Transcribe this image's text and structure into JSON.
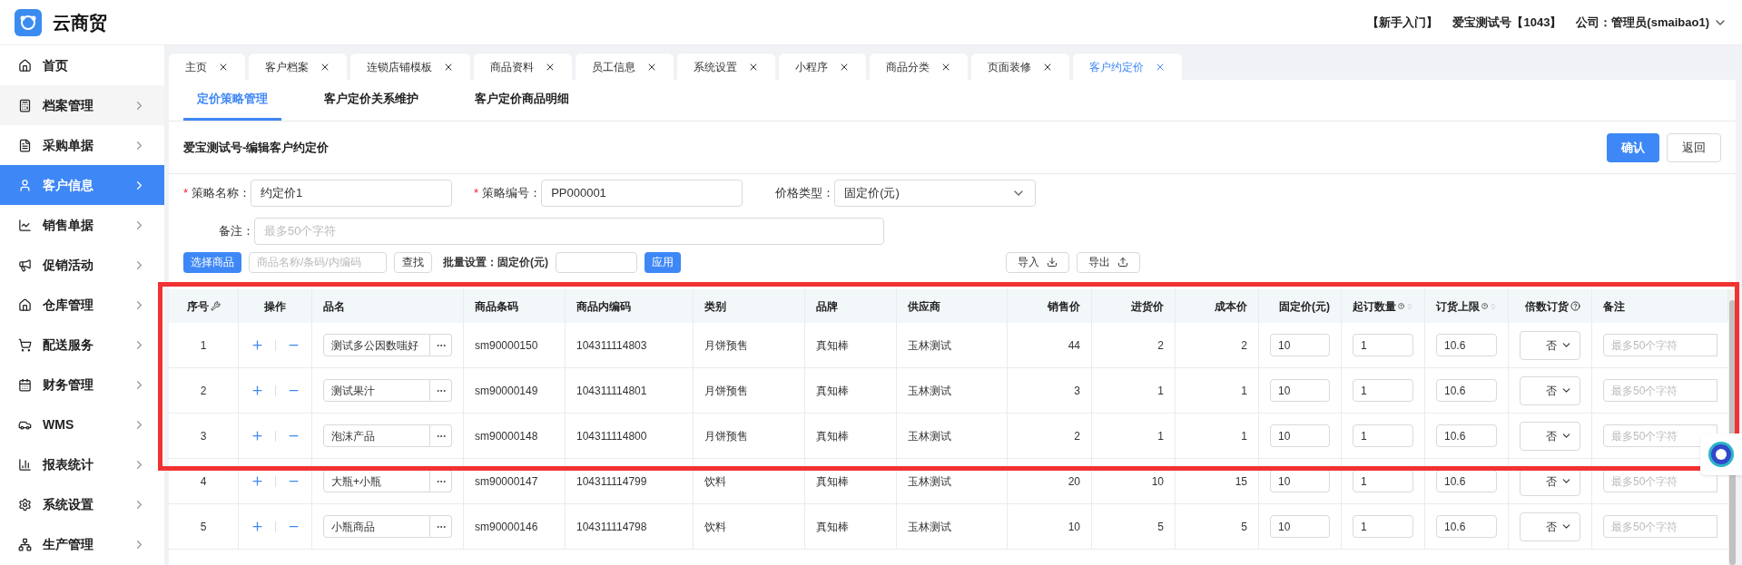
{
  "header": {
    "app_name": "云商贸",
    "links": [
      "【新手入门】",
      "爱宝测试号【1043】",
      "公司：管理员(smaibao1)"
    ]
  },
  "sidebar": {
    "items": [
      {
        "label": "首页",
        "expandable": false,
        "selected": false
      },
      {
        "label": "档案管理",
        "expandable": true,
        "selected": false
      },
      {
        "label": "采购单据",
        "expandable": true,
        "selected": false
      },
      {
        "label": "客户信息",
        "expandable": true,
        "selected": true
      },
      {
        "label": "销售单据",
        "expandable": true,
        "selected": false
      },
      {
        "label": "促销活动",
        "expandable": true,
        "selected": false
      },
      {
        "label": "仓库管理",
        "expandable": true,
        "selected": false
      },
      {
        "label": "配送服务",
        "expandable": true,
        "selected": false
      },
      {
        "label": "财务管理",
        "expandable": true,
        "selected": false
      },
      {
        "label": "WMS",
        "expandable": true,
        "selected": false
      },
      {
        "label": "报表统计",
        "expandable": true,
        "selected": false
      },
      {
        "label": "系统设置",
        "expandable": true,
        "selected": false
      },
      {
        "label": "生产管理",
        "expandable": true,
        "selected": false
      }
    ]
  },
  "tabs": [
    {
      "label": "主页",
      "selected": false
    },
    {
      "label": "客户档案",
      "selected": false
    },
    {
      "label": "连锁店铺模板",
      "selected": false
    },
    {
      "label": "商品资料",
      "selected": false
    },
    {
      "label": "员工信息",
      "selected": false
    },
    {
      "label": "系统设置",
      "selected": false
    },
    {
      "label": "小程序",
      "selected": false
    },
    {
      "label": "商品分类",
      "selected": false
    },
    {
      "label": "页面装修",
      "selected": false
    },
    {
      "label": "客户约定价",
      "selected": true
    }
  ],
  "subtabs": [
    {
      "label": "定价策略管理",
      "selected": true
    },
    {
      "label": "客户定价关系维护",
      "selected": false
    },
    {
      "label": "客户定价商品明细",
      "selected": false
    }
  ],
  "page_title": "爱宝测试号-编辑客户约定价",
  "actions": {
    "confirm": "确认",
    "back": "返回"
  },
  "form": {
    "name": {
      "required_mark": "*",
      "label": "策略名称：",
      "value": "约定价1"
    },
    "code": {
      "required_mark": "*",
      "label": "策略编号：",
      "value": "PP000001"
    },
    "price_type": {
      "label": "价格类型：",
      "value": "固定价(元)"
    },
    "remark": {
      "label": "备注：",
      "placeholder": "最多50个字符"
    }
  },
  "toolbar": {
    "select_button": "选择商品",
    "search_placeholder": "商品名称/条码/内编码",
    "find_button": "查找",
    "batch_label": "批量设置：固定价(元)",
    "apply_button": "应用",
    "import_button": "导入",
    "export_button": "导出"
  },
  "table": {
    "columns": [
      {
        "label": "序号",
        "help": false,
        "sortable": false
      },
      {
        "label": "操作",
        "help": false,
        "sortable": false
      },
      {
        "label": "品名",
        "help": false,
        "sortable": false
      },
      {
        "label": "商品条码",
        "help": false,
        "sortable": false
      },
      {
        "label": "商品内编码",
        "help": false,
        "sortable": false
      },
      {
        "label": "类别",
        "help": false,
        "sortable": false
      },
      {
        "label": "品牌",
        "help": false,
        "sortable": false
      },
      {
        "label": "供应商",
        "help": false,
        "sortable": false
      },
      {
        "label": "销售价",
        "help": false,
        "sortable": false
      },
      {
        "label": "进货价",
        "help": false,
        "sortable": false
      },
      {
        "label": "成本价",
        "help": false,
        "sortable": false
      },
      {
        "label": "固定价(元)",
        "help": false,
        "sortable": false
      },
      {
        "label": "起订数量",
        "help": true,
        "sortable": true
      },
      {
        "label": "订货上限",
        "help": true,
        "sortable": true
      },
      {
        "label": "倍数订货",
        "help": true,
        "sortable": false
      },
      {
        "label": "备注",
        "help": false,
        "sortable": false
      }
    ],
    "rows": [
      {
        "index": "1",
        "name": "测试多公因数嗤好",
        "barcode": "sm90000150",
        "code": "104311114803",
        "category": "月饼预售",
        "brand": "真知棒",
        "supplier": "玉林测试",
        "sale_price": "44",
        "purchase_price": "2",
        "cost_price": "2",
        "fixed_price": "10",
        "min_qty": "1",
        "max_qty": "10.6",
        "multiple": "否",
        "remark_placeholder": "最多50个字符"
      },
      {
        "index": "2",
        "name": "测试果汁",
        "barcode": "sm90000149",
        "code": "104311114801",
        "category": "月饼预售",
        "brand": "真知棒",
        "supplier": "玉林测试",
        "sale_price": "3",
        "purchase_price": "1",
        "cost_price": "1",
        "fixed_price": "10",
        "min_qty": "1",
        "max_qty": "10.6",
        "multiple": "否",
        "remark_placeholder": "最多50个字符"
      },
      {
        "index": "3",
        "name": "泡沫产品",
        "barcode": "sm90000148",
        "code": "104311114800",
        "category": "月饼预售",
        "brand": "真知棒",
        "supplier": "玉林测试",
        "sale_price": "2",
        "purchase_price": "1",
        "cost_price": "1",
        "fixed_price": "10",
        "min_qty": "1",
        "max_qty": "10.6",
        "multiple": "否",
        "remark_placeholder": "最多50个字符"
      },
      {
        "index": "4",
        "name": "大瓶+小瓶",
        "barcode": "sm90000147",
        "code": "104311114799",
        "category": "饮料",
        "brand": "真知棒",
        "supplier": "玉林测试",
        "sale_price": "20",
        "purchase_price": "10",
        "cost_price": "15",
        "fixed_price": "10",
        "min_qty": "1",
        "max_qty": "10.6",
        "multiple": "否",
        "remark_placeholder": "最多50个字符"
      },
      {
        "index": "5",
        "name": "小瓶商品",
        "barcode": "sm90000146",
        "code": "104311114798",
        "category": "饮料",
        "brand": "真知棒",
        "supplier": "玉林测试",
        "sale_price": "10",
        "purchase_price": "5",
        "cost_price": "5",
        "fixed_price": "10",
        "min_qty": "1",
        "max_qty": "10.6",
        "multiple": "否",
        "remark_placeholder": "最多50个字符"
      }
    ]
  }
}
